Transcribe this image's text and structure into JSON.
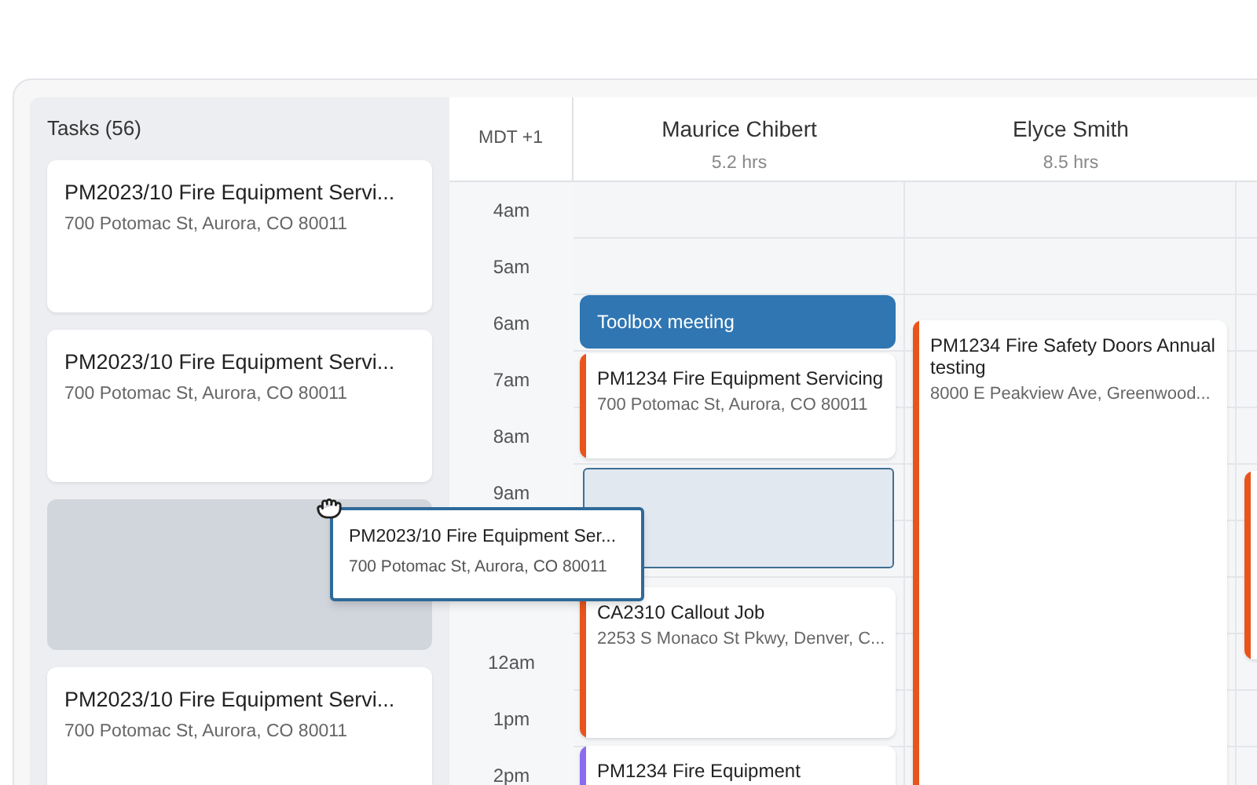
{
  "tasks_panel": {
    "title": "Tasks (56)",
    "items": [
      {
        "kind": "task",
        "title": "PM2023/10 Fire Equipment Servi...",
        "address": "700 Potomac St, Aurora, CO 80011"
      },
      {
        "kind": "task",
        "title": "PM2023/10 Fire Equipment Servi...",
        "address": "700 Potomac St, Aurora, CO 80011"
      },
      {
        "kind": "placeholder"
      },
      {
        "kind": "task",
        "title": "PM2023/10 Fire Equipment Servi...",
        "address": "700 Potomac St, Aurora, CO 80011"
      }
    ]
  },
  "calendar": {
    "timezone": "MDT +1",
    "hours": [
      {
        "label": "4am"
      },
      {
        "label": "5am"
      },
      {
        "label": "6am"
      },
      {
        "label": "7am"
      },
      {
        "label": "8am"
      },
      {
        "label": "9am"
      },
      {
        "label": "12am"
      },
      {
        "label": "1pm"
      },
      {
        "label": "2pm"
      }
    ],
    "columns": [
      {
        "name": "Maurice Chibert",
        "hours": "5.2 hrs",
        "events": [
          {
            "kind": "meeting",
            "title": "Toolbox meeting",
            "color": "#2f76b3"
          },
          {
            "kind": "task",
            "title": "PM1234 Fire Equipment Servicing",
            "address": "700 Potomac St, Aurora, CO 80011",
            "color": "#e8541c"
          },
          {
            "kind": "placeholder"
          },
          {
            "kind": "task",
            "title": "CA2310 Callout Job",
            "address": "2253 S Monaco St Pkwy, Denver, C...",
            "color": "#e8541c"
          },
          {
            "kind": "task",
            "title": "PM1234 Fire Equipment",
            "color": "#8b6cf0"
          }
        ]
      },
      {
        "name": "Elyce Smith",
        "hours": "8.5 hrs",
        "events": [
          {
            "kind": "task",
            "title": "PM1234 Fire Safety Doors Annual testing",
            "address": "8000 E Peakview Ave, Greenwood...",
            "color": "#e8541c"
          }
        ]
      },
      {
        "events": [
          {
            "kind": "task",
            "color": "#e8541c"
          }
        ]
      }
    ]
  },
  "drag_card": {
    "title": "PM2023/10 Fire Equipment Ser...",
    "address": "700 Potomac St, Aurora, CO 80011"
  }
}
